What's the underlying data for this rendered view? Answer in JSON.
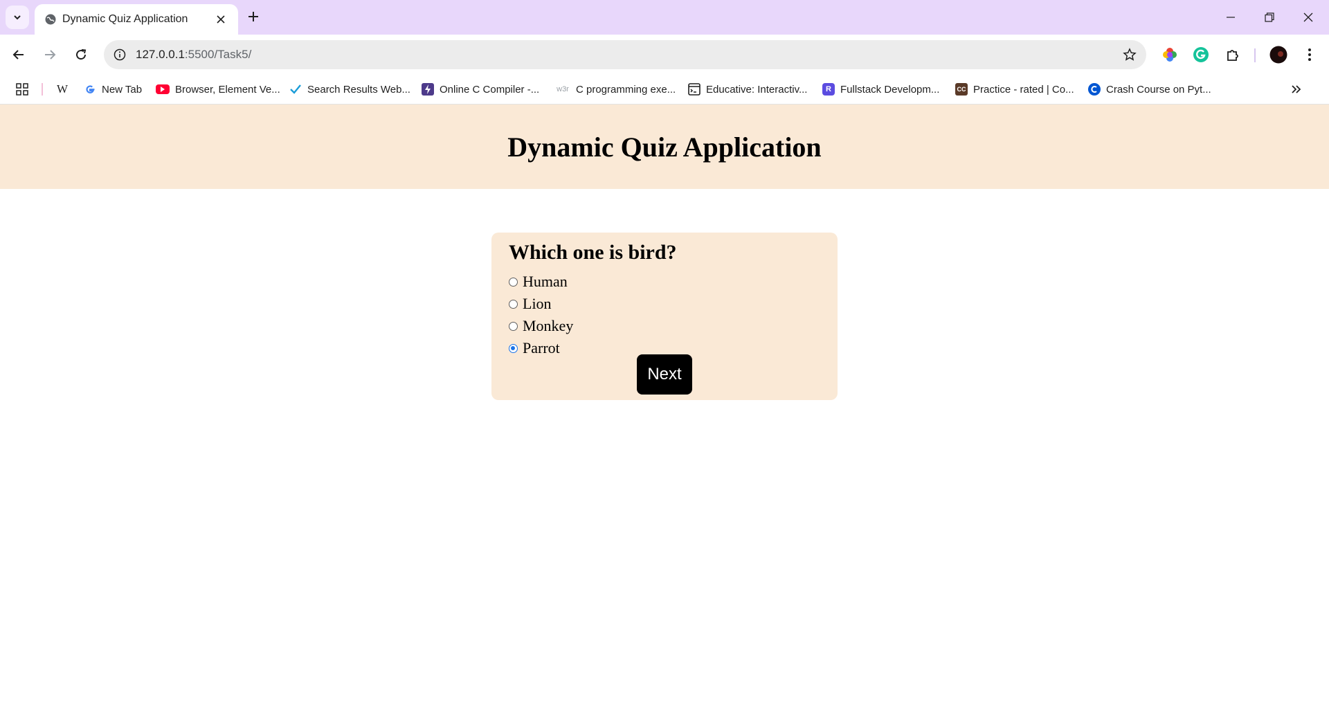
{
  "browser": {
    "tab": {
      "title": "Dynamic Quiz Application"
    },
    "address": {
      "host": "127.0.0.1",
      "path": ":5500/Task5/"
    },
    "bookmarks": [
      {
        "label": "",
        "icon": "wikipedia-icon"
      },
      {
        "label": "New Tab",
        "icon": "google-icon"
      },
      {
        "label": "Browser, Element Ve...",
        "icon": "youtube-icon"
      },
      {
        "label": "Search Results Web...",
        "icon": "check-icon"
      },
      {
        "label": "Online C Compiler -...",
        "icon": "bolt-icon"
      },
      {
        "label": "C programming exe...",
        "icon": "w3r-icon"
      },
      {
        "label": "Educative: Interactiv...",
        "icon": "educative-icon"
      },
      {
        "label": "Fullstack Developm...",
        "icon": "r-icon"
      },
      {
        "label": "Practice - rated | Co...",
        "icon": "cc-icon"
      },
      {
        "label": "Crash Course on Pyt...",
        "icon": "coursera-icon"
      }
    ],
    "icons": {
      "wikipedia": "W",
      "cc": "CC",
      "r": "R",
      "w3r": "w3r"
    }
  },
  "page": {
    "heading": "Dynamic Quiz Application",
    "quiz": {
      "question": "Which one is bird?",
      "options": [
        {
          "label": "Human",
          "selected": false
        },
        {
          "label": "Lion",
          "selected": false
        },
        {
          "label": "Monkey",
          "selected": false
        },
        {
          "label": "Parrot",
          "selected": true
        }
      ],
      "next_label": "Next"
    }
  },
  "colors": {
    "tabstrip": "#e8d7fb",
    "page_header_bg": "#fae9d6",
    "card_bg": "#fae9d6",
    "button_bg": "#000000",
    "radio_accent": "#1a73e8"
  }
}
